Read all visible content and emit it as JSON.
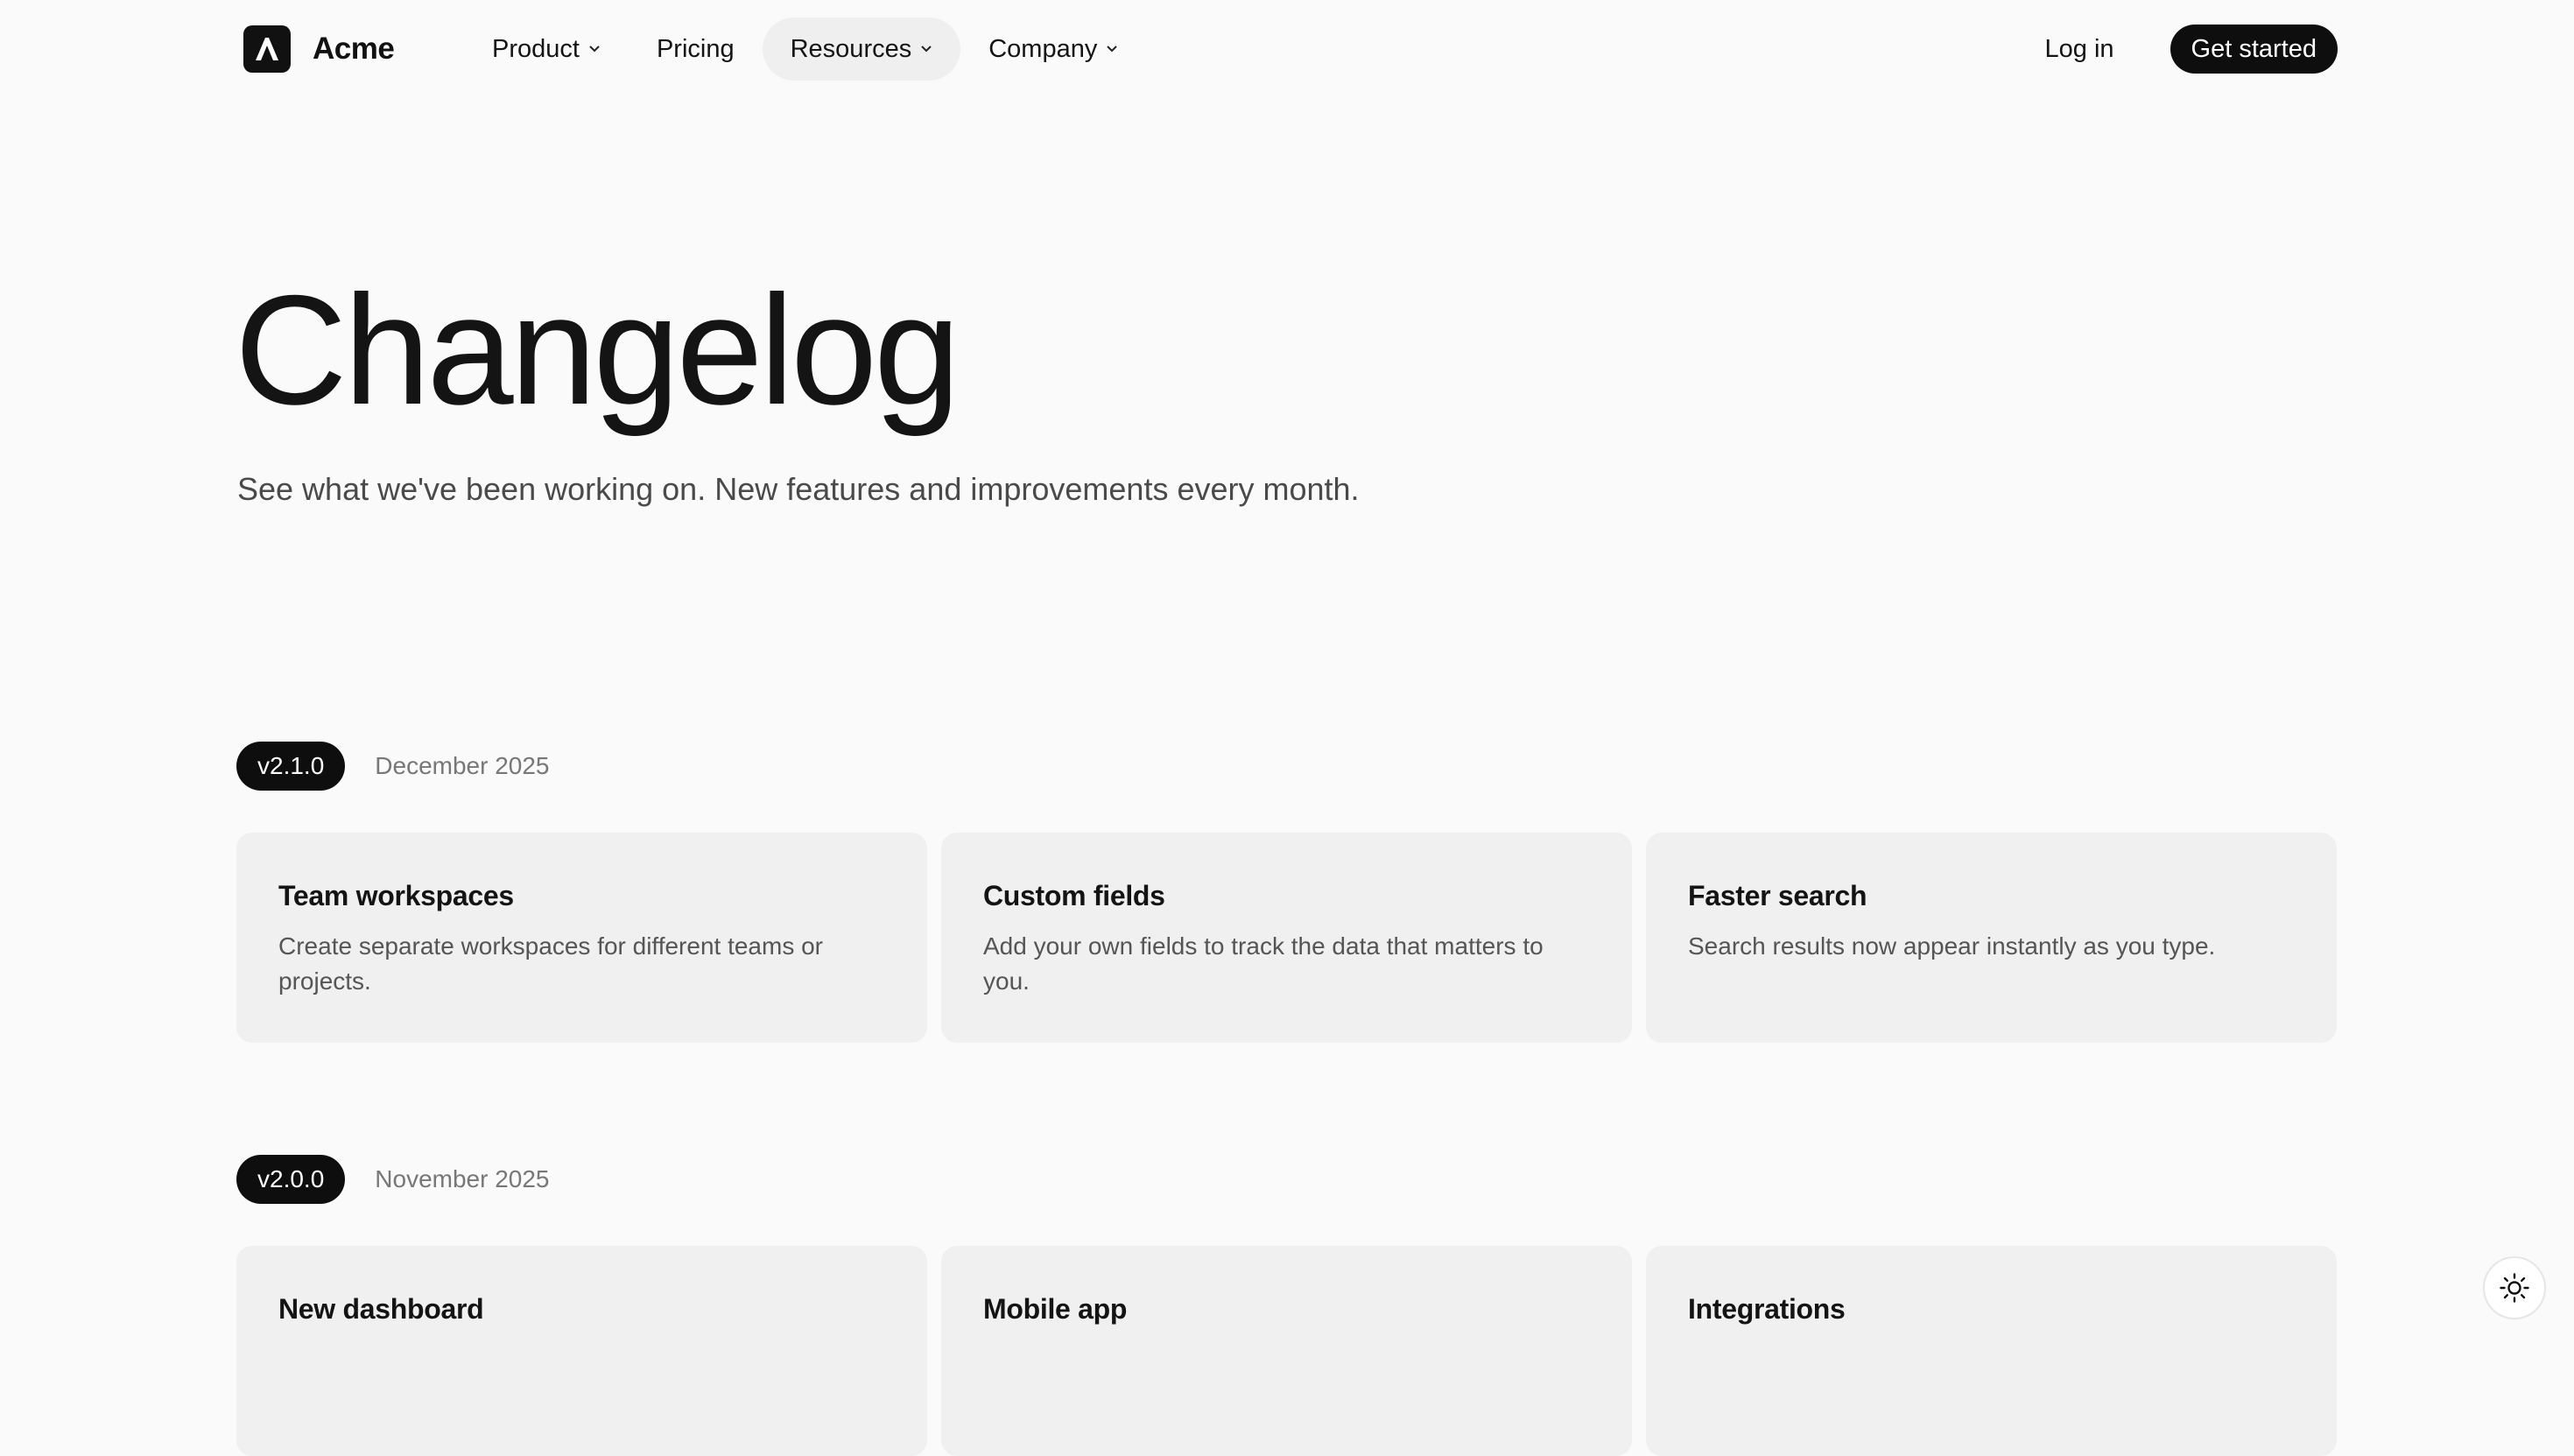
{
  "brand": {
    "name": "Acme",
    "logo_icon": "acme-logo-icon"
  },
  "nav": {
    "items": [
      {
        "label": "Product",
        "has_dropdown": true,
        "active": false
      },
      {
        "label": "Pricing",
        "has_dropdown": false,
        "active": false
      },
      {
        "label": "Resources",
        "has_dropdown": true,
        "active": true
      },
      {
        "label": "Company",
        "has_dropdown": true,
        "active": false
      }
    ],
    "login_label": "Log in",
    "cta_label": "Get started"
  },
  "hero": {
    "title": "Changelog",
    "subtitle": "See what we've been working on. New features and improvements every month."
  },
  "releases": [
    {
      "version": "v2.1.0",
      "date": "December 2025",
      "features": [
        {
          "title": "Team workspaces",
          "description": "Create separate workspaces for different teams or projects."
        },
        {
          "title": "Custom fields",
          "description": "Add your own fields to track the data that matters to you."
        },
        {
          "title": "Faster search",
          "description": "Search results now appear instantly as you type."
        }
      ]
    },
    {
      "version": "v2.0.0",
      "date": "November 2025",
      "features": [
        {
          "title": "New dashboard",
          "description": ""
        },
        {
          "title": "Mobile app",
          "description": ""
        },
        {
          "title": "Integrations",
          "description": ""
        }
      ]
    }
  ],
  "theme_toggle": {
    "icon": "sun-icon"
  },
  "colors": {
    "background": "#fafafa",
    "card": "#f0f0f0",
    "primary": "#0e0e0e",
    "nav_active": "#efefef",
    "muted_text": "#777777"
  }
}
